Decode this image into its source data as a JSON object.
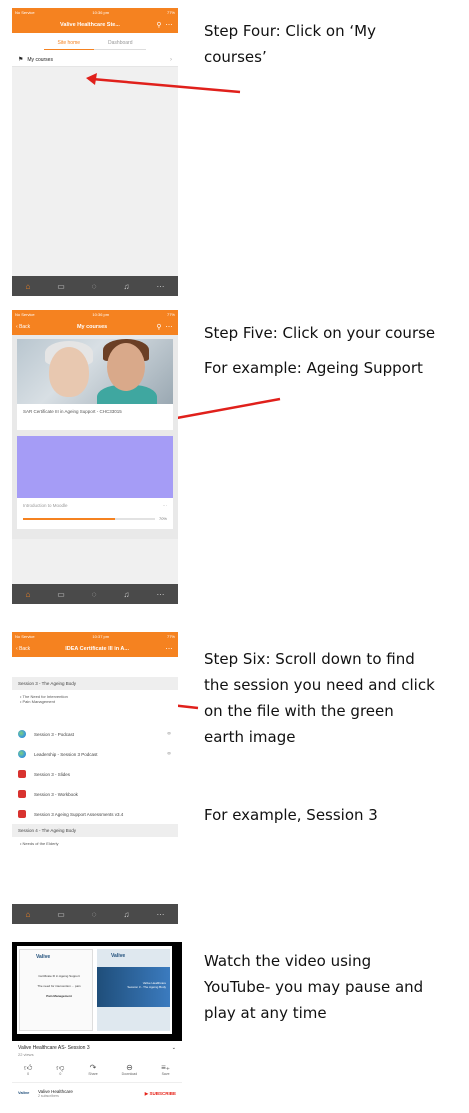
{
  "colors": {
    "accent": "#f58220",
    "arrow": "#e0201b",
    "tabbar": "#4a4a4a",
    "youtube_red": "#e62117"
  },
  "steps": [
    {
      "text_lines": [
        "Step Four: Click on ‘My",
        "courses’"
      ]
    },
    {
      "text_lines": [
        "Step Five: Click on your course",
        "For example: Ageing Support"
      ]
    },
    {
      "text_lines": [
        "Step Six: Scroll down to find",
        "the session you need and click",
        "on the file with the green",
        "earth image",
        "",
        "For example, Session 3"
      ]
    },
    {
      "text_lines": [
        "Watch the video using",
        "YouTube- you may pause and",
        "play at any time"
      ]
    }
  ],
  "phone1": {
    "status_left": "No Service",
    "status_time": "10:36 pm",
    "status_right": "77%",
    "title": "Valive Healthcare Ste...",
    "tabs": [
      "Site home",
      "Dashboard"
    ],
    "row_label": "My courses"
  },
  "phone2": {
    "status_time": "10:36 pm",
    "back": "Back",
    "title": "My courses",
    "course1_caption": "SAR Certificate III in Ageing Support - CHC33015",
    "course2_caption": "Introduction to Moodle",
    "course2_progress": 0.7,
    "course2_pct": "70%"
  },
  "phone3": {
    "status_time": "10:37 pm",
    "back": "Back",
    "title": "IDEA Certificate III in A...",
    "section3": "Session 3 - The Ageing Body",
    "bullets": [
      "The Need for Intervention",
      "Pain Management"
    ],
    "items": [
      {
        "icon": "earth-icon",
        "label": "Session 3 - Podcast",
        "kind": "earth"
      },
      {
        "icon": "earth-icon",
        "label": "Leadership - Session 3 Podcast",
        "kind": "earth"
      },
      {
        "icon": "pdf-icon",
        "label": "Session 3 - Slides",
        "kind": "pdf"
      },
      {
        "icon": "pdf-icon",
        "label": "Session 3 - Workbook",
        "kind": "pdf"
      },
      {
        "icon": "pdf-icon",
        "label": "Session 3 Ageing Support Assessments v3.4",
        "kind": "pdf"
      }
    ],
    "section4": "Session 4 - The Ageing Body",
    "bullets4": [
      "Needs of the Elderly"
    ]
  },
  "video": {
    "logo": "Valive",
    "slide_left_lines": [
      "Certificate III in Ageing Support",
      "The need for intervention ... pain",
      "Pain Management"
    ],
    "slide_right_lines": [
      "Valive Healthcare",
      "Session 3 - The Ageing Body"
    ],
    "title": "Valive Healthcare AS- Session 3",
    "views": "22 views",
    "actions": [
      {
        "icon": "thumbs-up-icon",
        "label": "0"
      },
      {
        "icon": "thumbs-down-icon",
        "label": "0"
      },
      {
        "icon": "share-icon",
        "label": "Share"
      },
      {
        "icon": "download-icon",
        "label": "Download"
      },
      {
        "icon": "save-icon",
        "label": "Save"
      }
    ],
    "channel": "Valive Healthcare",
    "subscribers": "2 subscribers",
    "subscribe": "SUBSCRIBE"
  }
}
